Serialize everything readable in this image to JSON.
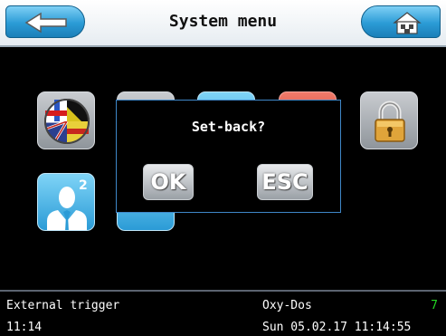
{
  "header": {
    "title": "System menu",
    "back_icon": "back-arrow-icon",
    "home_icon": "home-icon"
  },
  "menu_tiles": [
    {
      "name": "language-tile",
      "icon": "language-flags-icon"
    },
    {
      "name": "menu-tile-2",
      "icon": "unknown-icon"
    },
    {
      "name": "menu-tile-3",
      "icon": "unknown-icon"
    },
    {
      "name": "menu-tile-4",
      "icon": "unknown-icon"
    },
    {
      "name": "lock-tile",
      "icon": "padlock-icon"
    },
    {
      "name": "user-level-tile",
      "icon": "user-level-2-icon",
      "label": "2"
    },
    {
      "name": "menu-tile-7",
      "icon": "unknown-icon"
    }
  ],
  "dialog": {
    "title": "Set-back?",
    "ok_label": "OK",
    "esc_label": "ESC"
  },
  "status_bar": {
    "trigger_label": "External trigger",
    "time": "11:14",
    "mode_label": "Oxy-Dos",
    "mode_value": "7",
    "datetime": "Sun 05.02.17 11:14:55"
  },
  "colors": {
    "header_button_blue": "#2b9bd6",
    "dialog_border": "#3f87c8",
    "status_value_green": "#22d622"
  }
}
